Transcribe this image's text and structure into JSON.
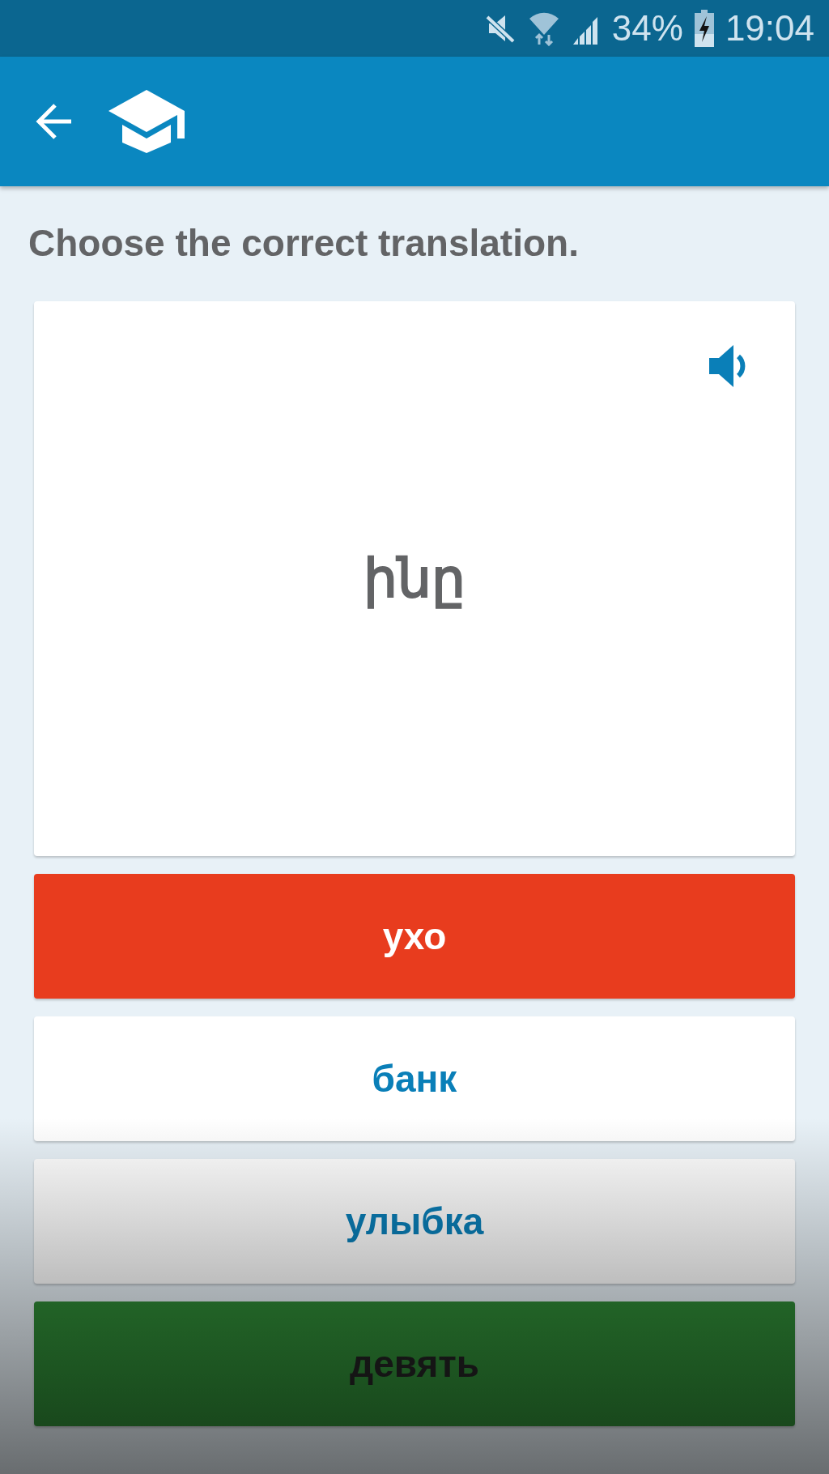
{
  "status_bar": {
    "battery": "34%",
    "time": "19:04"
  },
  "prompt": "Choose the correct translation.",
  "card": {
    "word": "ինը"
  },
  "options": [
    {
      "label": "ухо",
      "kind": "wrong"
    },
    {
      "label": "банк",
      "kind": "neutral"
    },
    {
      "label": "улыбка",
      "kind": "neutral"
    },
    {
      "label": "девять",
      "kind": "correct"
    }
  ]
}
